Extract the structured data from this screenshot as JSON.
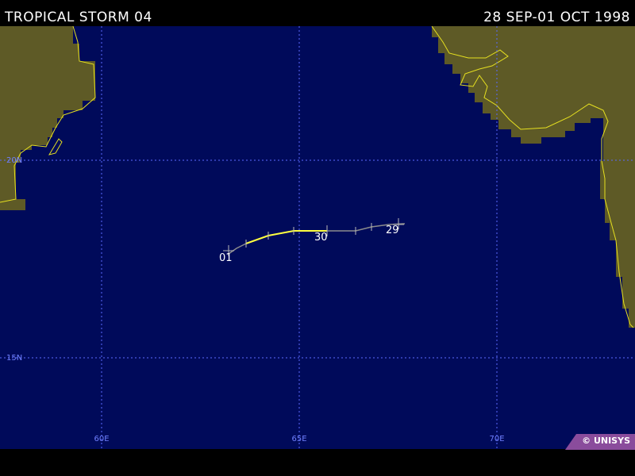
{
  "header": {
    "title": "TROPICAL STORM 04",
    "date_range": "28 SEP-01 OCT 1998"
  },
  "map": {
    "lat_labels": [
      "20N",
      "15N"
    ],
    "lon_labels": [
      "60E",
      "65E",
      "70E"
    ]
  },
  "track": {
    "day_labels": [
      "01",
      "30",
      "29"
    ],
    "points": [
      {
        "lon": 67.4,
        "lat": 18.4
      },
      {
        "lon": 66.8,
        "lat": 18.2
      },
      {
        "lon": 65.7,
        "lat": 18.2
      },
      {
        "lon": 64.8,
        "lat": 18.2
      },
      {
        "lon": 63.6,
        "lat": 17.9
      },
      {
        "lon": 63.2,
        "lat": 17.8
      }
    ]
  },
  "colors": {
    "ocean": "#000a5a",
    "land": "#5e5a26",
    "coastline": "#e6e020",
    "grid": "#5b6bff",
    "track_yellow": "#ffff40",
    "track_gray": "#8c8c8c",
    "badge": "#8a4c9c"
  },
  "footer": {
    "credit": "© UNISYS"
  }
}
